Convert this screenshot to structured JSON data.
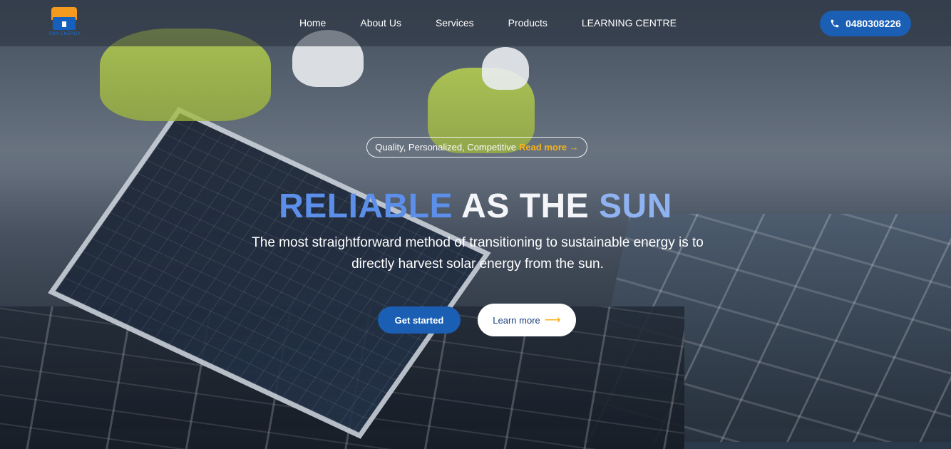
{
  "brand": {
    "logo_text": "SUN ENERGY",
    "colors": {
      "accent": "#1a5fb4",
      "highlight": "#f5b21b"
    }
  },
  "nav": {
    "items": [
      {
        "label": "Home"
      },
      {
        "label": "About Us"
      },
      {
        "label": "Services"
      },
      {
        "label": "Products"
      },
      {
        "label": "LEARNING CENTRE"
      }
    ],
    "phone": {
      "number": "0480308226",
      "icon": "phone-icon"
    }
  },
  "hero": {
    "tagline": "Quality, Personalized, Competitive",
    "tagline_link": "Read more",
    "tagline_arrow": "→",
    "headline": {
      "part1": "RELIABLE",
      "part2": "AS THE",
      "part3": "SUN"
    },
    "subtext": "The most straightforward method of transitioning to sustainable energy is to directly harvest solar energy from the sun.",
    "primary_button": "Get started",
    "secondary_button": "Learn more",
    "secondary_arrow": "⟶"
  }
}
